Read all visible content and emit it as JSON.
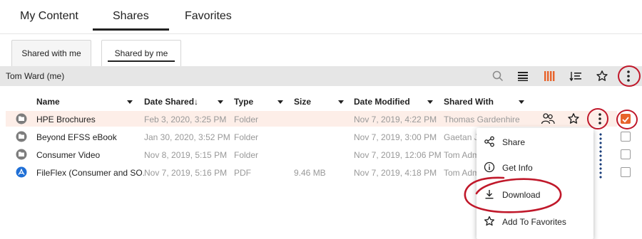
{
  "top_tabs": [
    "My Content",
    "Shares",
    "Favorites"
  ],
  "sub_tabs": [
    "Shared with me",
    "Shared by me"
  ],
  "toolbar": {
    "title": "Tom Ward (me)",
    "icons": [
      "search-icon",
      "list-view-icon",
      "column-view-icon",
      "sort-icon",
      "star-icon",
      "more-vertical-icon"
    ],
    "accent": "#e8632b"
  },
  "columns": [
    "Name",
    "Date Shared↓",
    "Type",
    "Size",
    "Date Modified",
    "Shared With"
  ],
  "rows": [
    {
      "name": "HPE Brochures",
      "date_shared": "Feb 3, 2020, 3:25 PM",
      "type": "Folder",
      "size": "",
      "date_modified": "Nov 7, 2019, 4:22 PM",
      "shared_with": "Thomas Gardenhire",
      "icon": "folder-icon",
      "selected": true,
      "checked": true
    },
    {
      "name": "Beyond EFSS eBook",
      "date_shared": "Jan 30, 2020, 3:52 PM",
      "type": "Folder",
      "size": "",
      "date_modified": "Nov 7, 2019, 3:00 PM",
      "shared_with": "Gaetan Je",
      "icon": "folder-icon",
      "selected": false,
      "checked": false
    },
    {
      "name": "Consumer Video",
      "date_shared": "Nov 8, 2019, 5:15 PM",
      "type": "Folder",
      "size": "",
      "date_modified": "Nov 7, 2019, 12:06 PM",
      "shared_with": "Tom Adm",
      "icon": "folder-icon",
      "selected": false,
      "checked": false
    },
    {
      "name": "FileFlex (Consumer and SO…",
      "date_shared": "Nov 7, 2019, 5:16 PM",
      "type": "PDF",
      "size": "9.46 MB",
      "date_modified": "Nov 7, 2019, 4:18 PM",
      "shared_with": "Tom Adm",
      "icon": "pdf-icon",
      "selected": false,
      "checked": false
    }
  ],
  "context_menu": [
    {
      "label": "Share",
      "icon": "share-icon"
    },
    {
      "label": "Get Info",
      "icon": "info-icon"
    },
    {
      "label": "Download",
      "icon": "download-icon"
    },
    {
      "label": "Add To Favorites",
      "icon": "star-icon"
    }
  ],
  "colors": {
    "toolbar_bg": "#e6e6e6",
    "selected_row": "#fdeee8",
    "annotation_red": "#c0182a",
    "pdf_blue": "#1f6fd6",
    "folder_gray": "#7d7d7d"
  }
}
